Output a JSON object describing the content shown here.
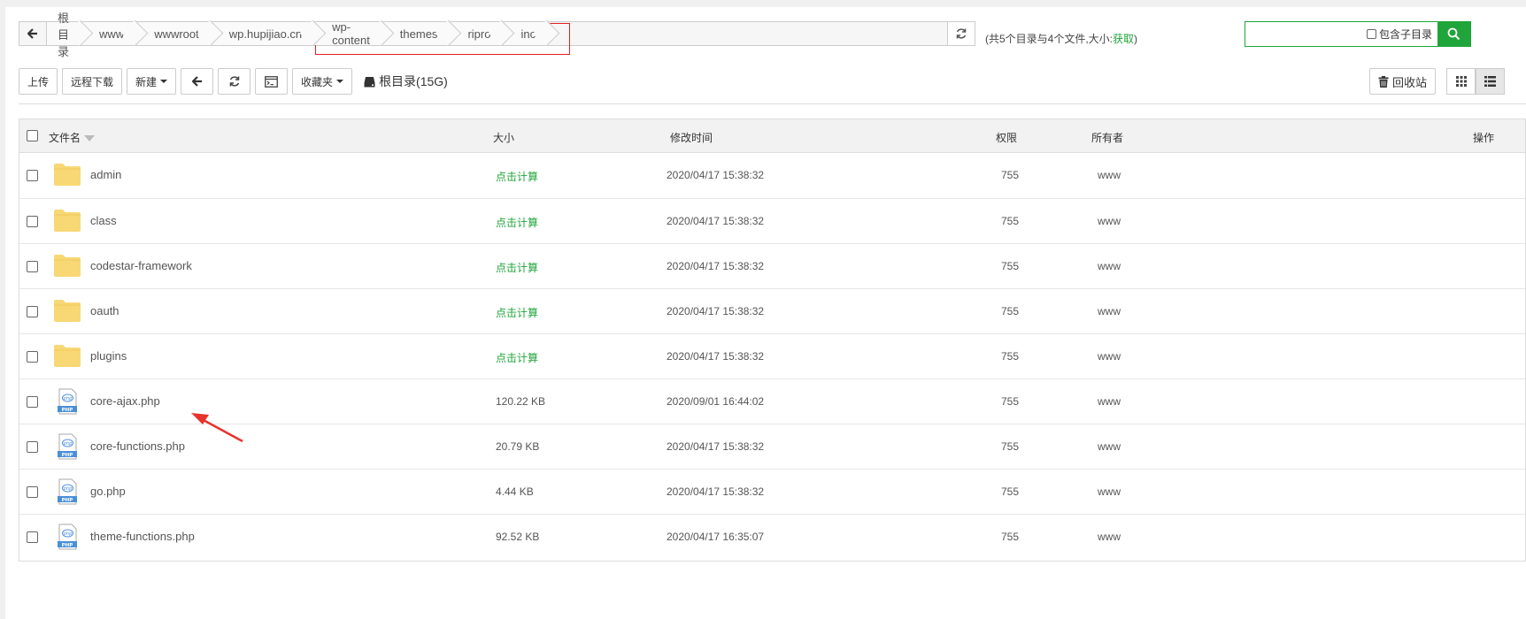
{
  "path": {
    "crumbs": [
      "根目录",
      "www",
      "wwwroot",
      "wp.hupijiao.cn",
      "wp-content",
      "themes",
      "ripro",
      "inc"
    ]
  },
  "summary": {
    "text": "(共5个目录与4个文件,大小:",
    "fetch_label": "获取",
    "close": ")"
  },
  "search": {
    "placeholder": "",
    "subdir_label": "包含子目录"
  },
  "toolbar": {
    "upload": "上传",
    "remote_download": "远程下载",
    "new": "新建",
    "favorites": "收藏夹",
    "disk_label": "根目录(15G)",
    "recycle": "回收站"
  },
  "table": {
    "headers": {
      "name": "文件名",
      "size": "大小",
      "mtime": "修改时间",
      "perm": "权限",
      "owner": "所有者",
      "ops": "操作"
    },
    "rows": [
      {
        "name": "admin",
        "type": "folder",
        "size": "点击计算",
        "mtime": "2020/04/17 15:38:32",
        "perm": "755",
        "owner": "www"
      },
      {
        "name": "class",
        "type": "folder",
        "size": "点击计算",
        "mtime": "2020/04/17 15:38:32",
        "perm": "755",
        "owner": "www"
      },
      {
        "name": "codestar-framework",
        "type": "folder",
        "size": "点击计算",
        "mtime": "2020/04/17 15:38:32",
        "perm": "755",
        "owner": "www"
      },
      {
        "name": "oauth",
        "type": "folder",
        "size": "点击计算",
        "mtime": "2020/04/17 15:38:32",
        "perm": "755",
        "owner": "www"
      },
      {
        "name": "plugins",
        "type": "folder",
        "size": "点击计算",
        "mtime": "2020/04/17 15:38:32",
        "perm": "755",
        "owner": "www"
      },
      {
        "name": "core-ajax.php",
        "type": "php",
        "size": "120.22 KB",
        "mtime": "2020/09/01 16:44:02",
        "perm": "755",
        "owner": "www"
      },
      {
        "name": "core-functions.php",
        "type": "php",
        "size": "20.79 KB",
        "mtime": "2020/04/17 15:38:32",
        "perm": "755",
        "owner": "www"
      },
      {
        "name": "go.php",
        "type": "php",
        "size": "4.44 KB",
        "mtime": "2020/04/17 15:38:32",
        "perm": "755",
        "owner": "www"
      },
      {
        "name": "theme-functions.php",
        "type": "php",
        "size": "92.52 KB",
        "mtime": "2020/04/17 16:35:07",
        "perm": "755",
        "owner": "www"
      }
    ]
  },
  "icons": {
    "php_badge": "PHP",
    "php_glyph": "php"
  },
  "colors": {
    "accent": "#20a53a",
    "highlight_box": "#e02020",
    "folder": "#f8d775",
    "php_blue": "#4a8fd8"
  }
}
